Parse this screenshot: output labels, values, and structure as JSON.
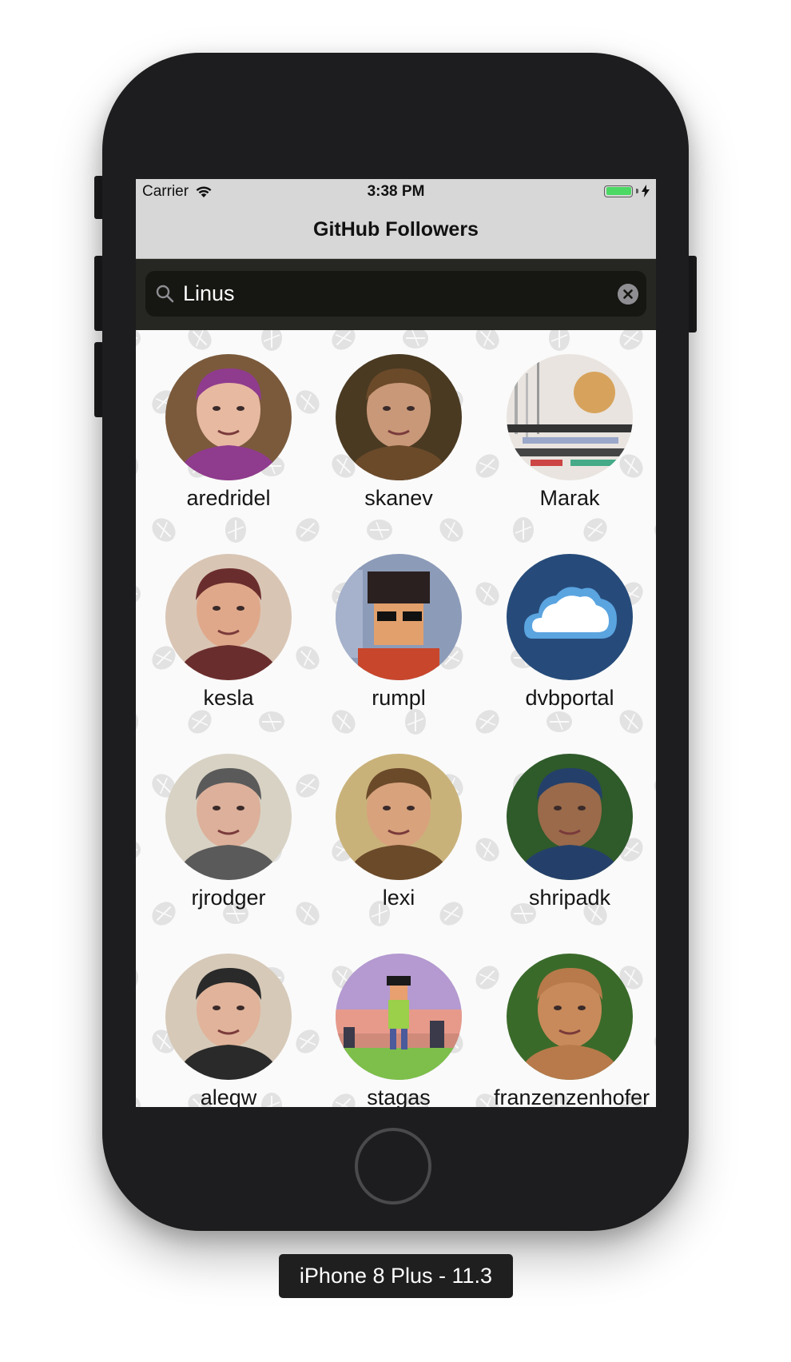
{
  "status_bar": {
    "carrier": "Carrier",
    "wifi_icon": "wifi-icon",
    "time": "3:38 PM",
    "battery_icon": "battery-charging-icon",
    "battery_level": 1.0,
    "charging_icon": "bolt-icon",
    "battery_color": "#4cd964"
  },
  "nav_bar": {
    "title": "GitHub Followers"
  },
  "search": {
    "value": "Linus",
    "search_icon": "magnifier-icon",
    "clear_icon": "clear-x-icon",
    "field_color": "#161612",
    "bar_color": "#262622"
  },
  "followers": [
    {
      "login": "aredridel",
      "avatar_bg": "#7b5a3c",
      "accent": "#8f3b8e",
      "skin": "#e7b9a1",
      "style": "photo"
    },
    {
      "login": "skanev",
      "avatar_bg": "#4a3a22",
      "accent": "#6b4a2a",
      "skin": "#c89878",
      "style": "photo"
    },
    {
      "login": "Marak",
      "avatar_bg": "#e9e4df",
      "accent": "#9aa7c9",
      "skin": "#d7a35c",
      "style": "glitch"
    },
    {
      "login": "kesla",
      "avatar_bg": "#d9c5b4",
      "accent": "#6a2d2d",
      "skin": "#e0a88a",
      "style": "photo"
    },
    {
      "login": "rumpl",
      "avatar_bg": "#8c9bb8",
      "accent": "#c8462c",
      "skin": "#e2a06c",
      "style": "pixel"
    },
    {
      "login": "dvbportal",
      "avatar_bg": "#264b7a",
      "accent": "#5aa4e0",
      "skin": "#ffffff",
      "style": "cloud"
    },
    {
      "login": "rjrodger",
      "avatar_bg": "#d8d2c4",
      "accent": "#5a5a5a",
      "skin": "#dcb09a",
      "style": "photo"
    },
    {
      "login": "lexi",
      "avatar_bg": "#c9b27a",
      "accent": "#6b4a2a",
      "skin": "#d7a27c",
      "style": "photo"
    },
    {
      "login": "shripadk",
      "avatar_bg": "#2f5a2a",
      "accent": "#24406a",
      "skin": "#9a6a4a",
      "style": "photo"
    },
    {
      "login": "aleqw",
      "avatar_bg": "#d6c9b8",
      "accent": "#2a2a2a",
      "skin": "#e0b39a",
      "style": "photo"
    },
    {
      "login": "stagas",
      "avatar_bg": "#b49ad0",
      "accent": "#7dbf4a",
      "skin": "#e8a070",
      "style": "pixelscene"
    },
    {
      "login": "franzenzenhofer",
      "avatar_bg": "#3a6a2a",
      "accent": "#b87a4a",
      "skin": "#c88a5a",
      "style": "photo"
    }
  ],
  "home_button_icon": "home-button",
  "device_label": "iPhone 8 Plus - 11.3"
}
